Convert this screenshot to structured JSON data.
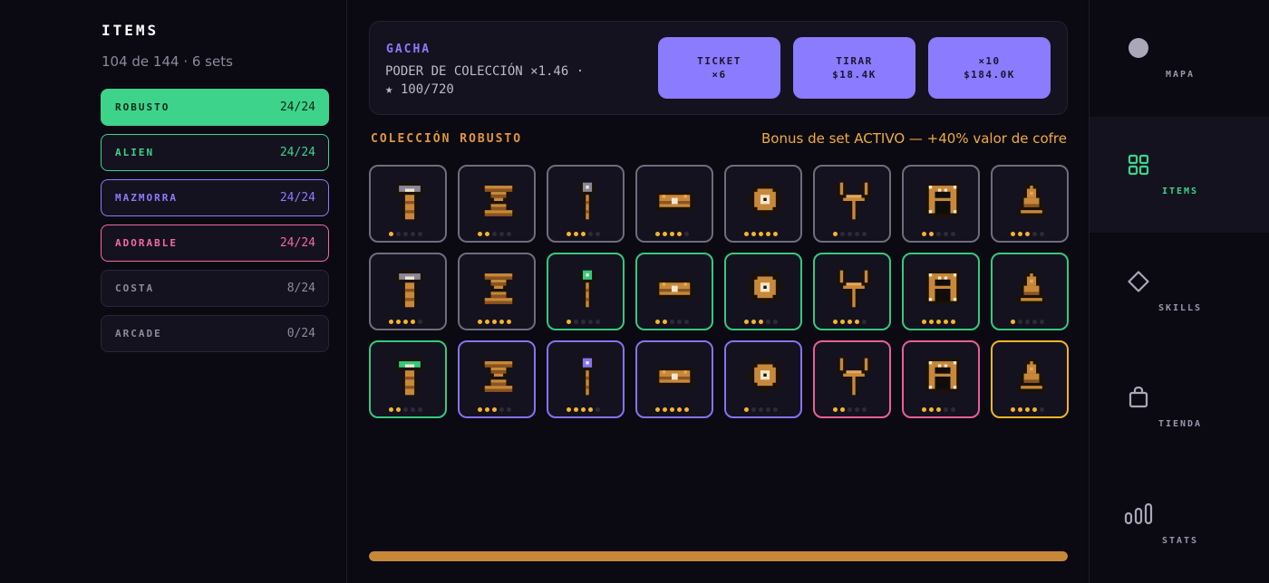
{
  "left": {
    "title": "ITEMS",
    "subtitle": "104 de 144 · 6 sets",
    "sets": [
      {
        "name": "ROBUSTO",
        "count": "24/24",
        "color": "#3ed38a",
        "active": true
      },
      {
        "name": "ALIEN",
        "count": "24/24",
        "color": "#3ed38a",
        "active": false
      },
      {
        "name": "MAZMORRA",
        "count": "24/24",
        "color": "#8b7cff",
        "active": false
      },
      {
        "name": "ADORABLE",
        "count": "24/24",
        "color": "#f06aa6",
        "active": false
      },
      {
        "name": "COSTA",
        "count": "8/24",
        "color": "#8d8a9c",
        "active": false
      },
      {
        "name": "ARCADE",
        "count": "0/24",
        "color": "#8d8a9c",
        "active": false
      }
    ]
  },
  "gacha": {
    "title": "GACHA",
    "power_line1": "PODER DE COLECCIÓN ×1.46  ·",
    "power_line2": "★ 100/720",
    "buttons": [
      {
        "line1": "TICKET",
        "line2": "×6"
      },
      {
        "line1": "TIRAR",
        "line2": "$18.4K"
      },
      {
        "line1": "×10",
        "line2": "$184.0K"
      }
    ]
  },
  "collection": {
    "title": "COLECCIÓN ROBUSTO",
    "bonus": "Bonus de set ACTIVO — +40% valor de cofre",
    "progress": 1.0
  },
  "items": [
    {
      "icon": "hammer-icon",
      "tier": "gray",
      "stars": 1
    },
    {
      "icon": "hourglass-icon",
      "tier": "gray",
      "stars": 2
    },
    {
      "icon": "wand-icon",
      "tier": "gray",
      "stars": 3
    },
    {
      "icon": "chest-icon",
      "tier": "gray",
      "stars": 4
    },
    {
      "icon": "gear-icon",
      "tier": "gray",
      "stars": 5
    },
    {
      "icon": "slingshot-icon",
      "tier": "gray",
      "stars": 1
    },
    {
      "icon": "frame-icon",
      "tier": "gray",
      "stars": 2
    },
    {
      "icon": "bell-icon",
      "tier": "gray",
      "stars": 3
    },
    {
      "icon": "hammer-icon",
      "tier": "gray",
      "stars": 4
    },
    {
      "icon": "hourglass-icon",
      "tier": "gray",
      "stars": 5
    },
    {
      "icon": "wand-icon",
      "tier": "green",
      "stars": 1
    },
    {
      "icon": "chest-icon",
      "tier": "green",
      "stars": 2
    },
    {
      "icon": "gear-icon",
      "tier": "green",
      "stars": 3
    },
    {
      "icon": "slingshot-icon",
      "tier": "green",
      "stars": 4
    },
    {
      "icon": "frame-icon",
      "tier": "green",
      "stars": 5
    },
    {
      "icon": "bell-icon",
      "tier": "green",
      "stars": 1
    },
    {
      "icon": "hammer-icon",
      "tier": "green",
      "stars": 2
    },
    {
      "icon": "hourglass-icon",
      "tier": "purple",
      "stars": 3
    },
    {
      "icon": "wand-icon",
      "tier": "purple",
      "stars": 4
    },
    {
      "icon": "chest-icon",
      "tier": "purple",
      "stars": 5
    },
    {
      "icon": "gear-icon",
      "tier": "purple",
      "stars": 1
    },
    {
      "icon": "slingshot-icon",
      "tier": "pink",
      "stars": 2
    },
    {
      "icon": "frame-icon",
      "tier": "pink",
      "stars": 3
    },
    {
      "icon": "bell-icon",
      "tier": "gold",
      "stars": 4
    }
  ],
  "tier_colors": {
    "gray": "#6f6c7c",
    "green": "#34c97e",
    "purple": "#8474f0",
    "pink": "#e85f98",
    "gold": "#f0b429"
  },
  "nav": [
    {
      "label": "MAPA",
      "icon": "circle-icon",
      "active": false
    },
    {
      "label": "ITEMS",
      "icon": "grid-icon",
      "active": true
    },
    {
      "label": "SKILLS",
      "icon": "diamond-icon",
      "active": false
    },
    {
      "label": "TIENDA",
      "icon": "bag-icon",
      "active": false
    },
    {
      "label": "STATS",
      "icon": "bars-icon",
      "active": false
    }
  ]
}
